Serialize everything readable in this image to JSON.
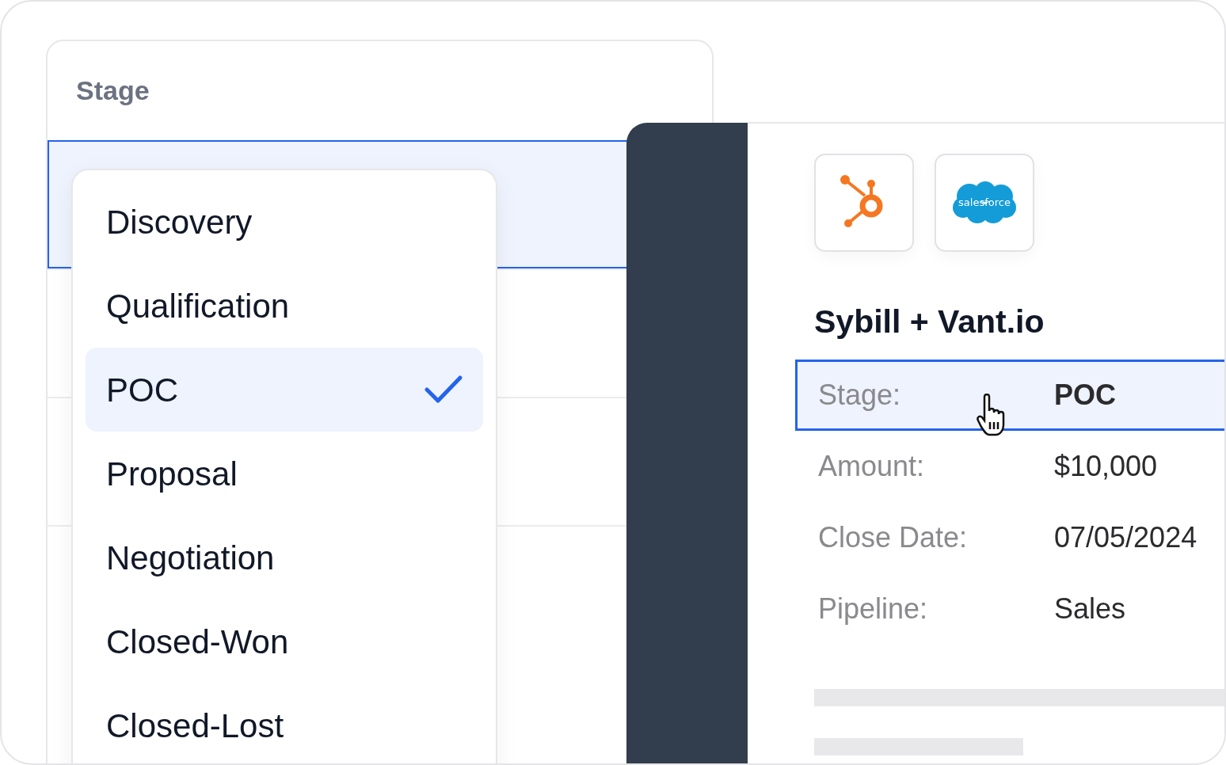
{
  "stage_column": {
    "header": "Stage"
  },
  "stage_menu": {
    "options": [
      {
        "label": "Discovery",
        "selected": false
      },
      {
        "label": "Qualification",
        "selected": false
      },
      {
        "label": "POC",
        "selected": true
      },
      {
        "label": "Proposal",
        "selected": false
      },
      {
        "label": "Negotiation",
        "selected": false
      },
      {
        "label": "Closed-Won",
        "selected": false
      },
      {
        "label": "Closed-Lost",
        "selected": false
      }
    ]
  },
  "deal": {
    "logo_text": "salesforce",
    "title": "Sybill + Vant.io",
    "fields": [
      {
        "label": "Stage:",
        "value": "POC",
        "selected": true
      },
      {
        "label": "Amount:",
        "value": "$10,000",
        "selected": false
      },
      {
        "label": "Close Date:",
        "value": "07/05/2024",
        "selected": false
      },
      {
        "label": "Pipeline:",
        "value": "Sales",
        "selected": false
      }
    ]
  }
}
